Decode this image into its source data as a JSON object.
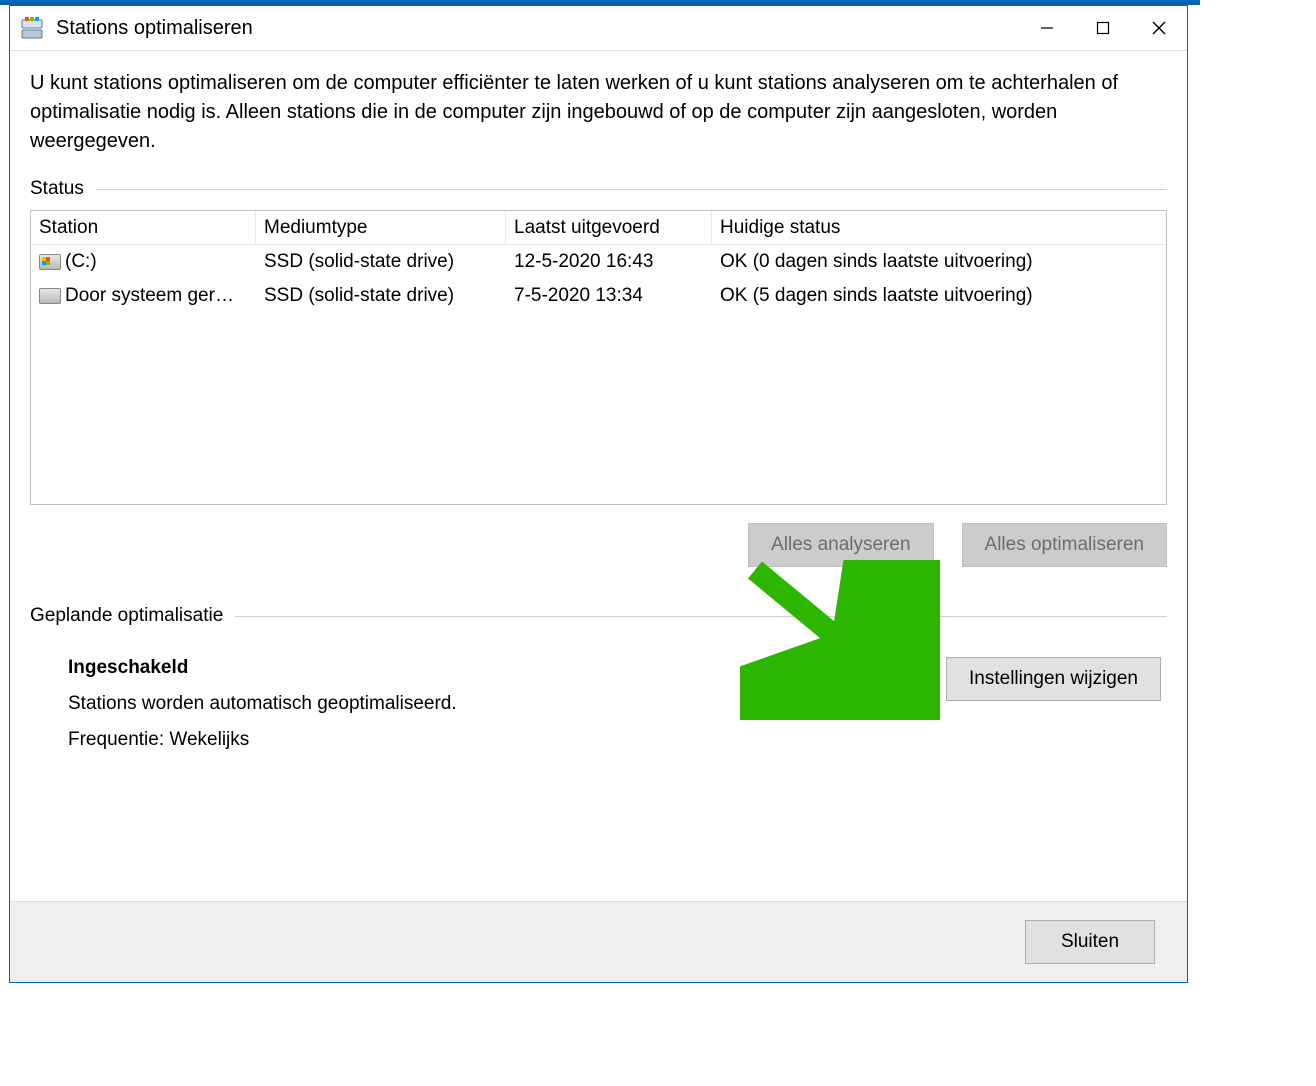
{
  "window": {
    "title": "Stations optimaliseren"
  },
  "description": "U kunt stations optimaliseren om de computer efficiënter te laten werken of u kunt stations analyseren om te achterhalen of optimalisatie nodig is. Alleen stations die in de computer zijn ingebouwd of op de computer zijn aangesloten, worden weergegeven.",
  "sections": {
    "status_label": "Status",
    "schedule_label": "Geplande optimalisatie"
  },
  "table": {
    "headers": {
      "station": "Station",
      "type": "Mediumtype",
      "last": "Laatst uitgevoerd",
      "status": "Huidige status"
    },
    "rows": [
      {
        "station": "(C:)",
        "type": "SSD (solid-state drive)",
        "last": "12-5-2020 16:43",
        "status": "OK (0 dagen sinds laatste uitvoering)",
        "icon": "win"
      },
      {
        "station": "Door systeem ger…",
        "type": "SSD (solid-state drive)",
        "last": "7-5-2020 13:34",
        "status": "OK (5 dagen sinds laatste uitvoering)",
        "icon": "drive"
      }
    ]
  },
  "buttons": {
    "analyze": "Alles analyseren",
    "optimize": "Alles optimaliseren",
    "change_settings": "Instellingen wijzigen",
    "close": "Sluiten"
  },
  "schedule": {
    "enabled_title": "Ingeschakeld",
    "auto_text": "Stations worden automatisch geoptimaliseerd.",
    "frequency": "Frequentie: Wekelijks"
  }
}
